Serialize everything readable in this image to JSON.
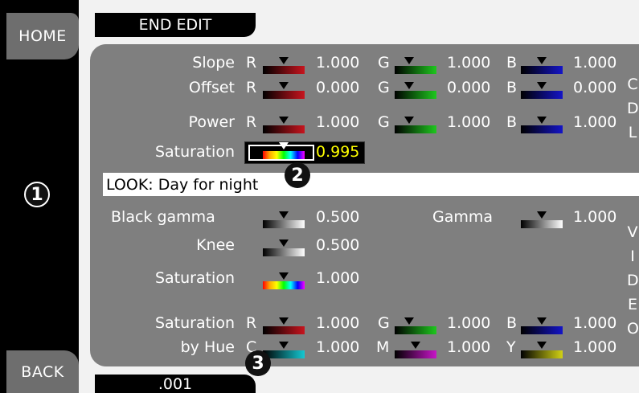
{
  "sidebar": {
    "home_label": "HOME",
    "back_label": "BACK",
    "callout_1": "1"
  },
  "header": {
    "end_edit_label": "END EDIT"
  },
  "footer": {
    "step_value": ".001"
  },
  "cdl": {
    "rows": [
      {
        "label": "Slope",
        "r": "1.000",
        "g": "1.000",
        "b": "1.000"
      },
      {
        "label": "Offset",
        "r": "0.000",
        "g": "0.000",
        "b": "0.000"
      },
      {
        "label": "Power",
        "r": "1.000",
        "g": "1.000",
        "b": "1.000"
      }
    ],
    "channel_r": "R",
    "channel_g": "G",
    "channel_b": "B",
    "saturation_label": "Saturation",
    "saturation_value": "0.995",
    "side_letters": [
      "C",
      "D",
      "L"
    ]
  },
  "look": {
    "text": "LOOK: Day for night"
  },
  "callouts": {
    "c2": "2",
    "c3": "3"
  },
  "video": {
    "black_gamma_label": "Black gamma",
    "black_gamma_value": "0.500",
    "gamma_label": "Gamma",
    "gamma_value": "1.000",
    "knee_label": "Knee",
    "knee_value": "0.500",
    "saturation_label": "Saturation",
    "saturation_value": "1.000",
    "sat_by_hue_label_1": "Saturation",
    "sat_by_hue_label_2": "by Hue",
    "hue_r": "1.000",
    "hue_g": "1.000",
    "hue_b": "1.000",
    "hue_c": "1.000",
    "hue_m": "1.000",
    "hue_y": "1.000",
    "ch_r": "R",
    "ch_g": "G",
    "ch_b": "B",
    "ch_c": "C",
    "ch_m": "M",
    "ch_y": "Y",
    "side_letters": [
      "V",
      "I",
      "D",
      "E",
      "O"
    ]
  },
  "colors": {
    "panel": "#7f7f7f",
    "red": "#c8141e",
    "green": "#1ec81e",
    "blue": "#1414c8",
    "cyan": "#14c8d2",
    "magenta": "#c814c8",
    "yellow": "#d2d214",
    "highlight": "#ffff00"
  }
}
